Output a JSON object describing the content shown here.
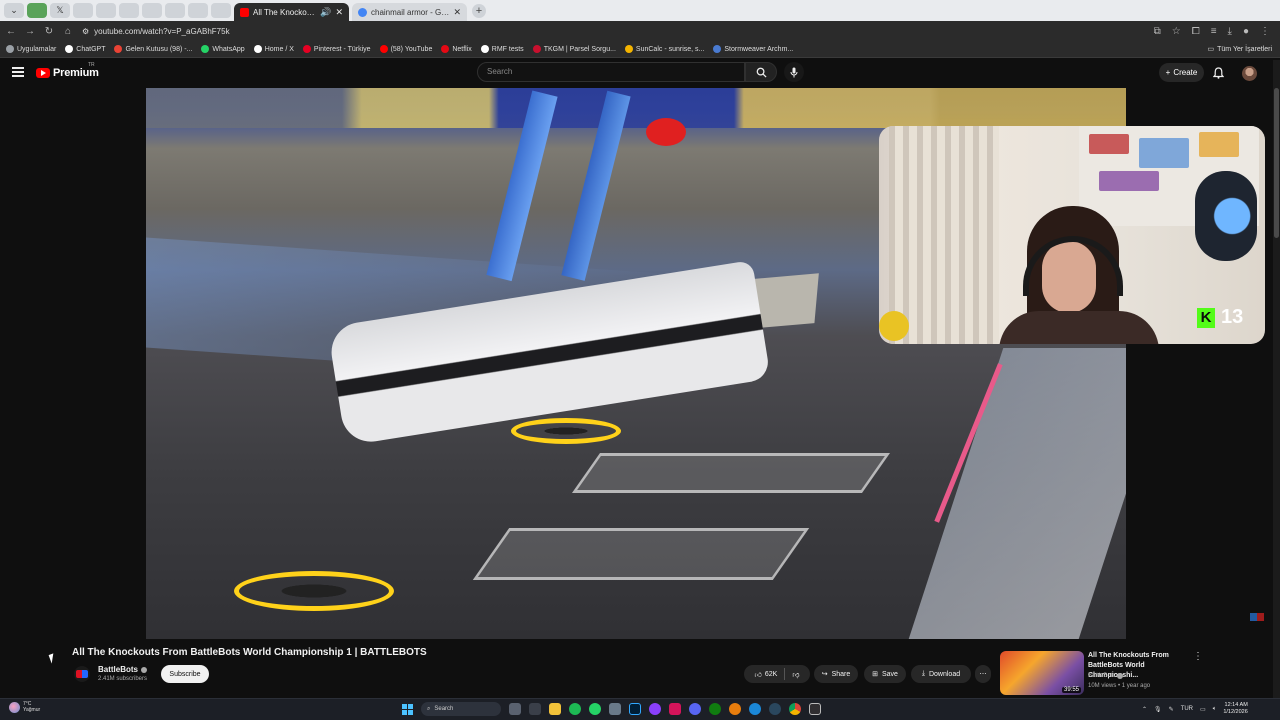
{
  "browser": {
    "tabs": [
      {
        "title": "All The Knockouts From Ba",
        "active": true,
        "color": "#ff0000"
      },
      {
        "title": "chainmail armor - Google'da A",
        "active": false,
        "color": "#4285f4"
      }
    ],
    "url": "youtube.com/watch?v=P_aGABhF75k",
    "bookmarks": [
      {
        "label": "Uygulamalar",
        "color": "#9aa0a6"
      },
      {
        "label": "ChatGPT",
        "color": "#ffffff"
      },
      {
        "label": "Gelen Kutusu (98) -...",
        "color": "#ea4335"
      },
      {
        "label": "WhatsApp",
        "color": "#25d366"
      },
      {
        "label": "Home / X",
        "color": "#ffffff"
      },
      {
        "label": "Pinterest - Türkiye",
        "color": "#e60023"
      },
      {
        "label": "(58) YouTube",
        "color": "#ff0000"
      },
      {
        "label": "Netflix",
        "color": "#e50914"
      },
      {
        "label": "RMF tests",
        "color": "#ffffff"
      },
      {
        "label": "TKGM | Parsel Sorgu...",
        "color": "#c8102e"
      },
      {
        "label": "SunCalc - sunrise, s...",
        "color": "#f4b400"
      },
      {
        "label": "Stormweaver Archm...",
        "color": "#4a7bd1"
      }
    ],
    "bookmarks_all": "Tüm Yer İşaretleri"
  },
  "youtube": {
    "logo": "Premium",
    "region": "TR",
    "search_placeholder": "Search",
    "create_label": "Create"
  },
  "overlay": {
    "kick_count": "13",
    "kick_color": "#53fc18"
  },
  "video": {
    "title": "All The Knockouts From BattleBots World Championship 1 | BATTLEBOTS",
    "channel": "BattleBots",
    "subscribers": "2.41M subscribers",
    "subscribe_label": "Subscribe",
    "likes": "62K",
    "share_label": "Share",
    "save_label": "Save",
    "download_label": "Download"
  },
  "related": {
    "title": "All The Knockouts From BattleBots World Championshi...",
    "channel": "BattleBots",
    "meta": "10M views • 1 year ago",
    "duration": "39:55"
  },
  "taskbar": {
    "weather_temp": "7°C",
    "weather_desc": "Yağmur",
    "search_label": "Search",
    "language": "TUR",
    "time": "12:14 AM",
    "date": "1/12/2026"
  }
}
